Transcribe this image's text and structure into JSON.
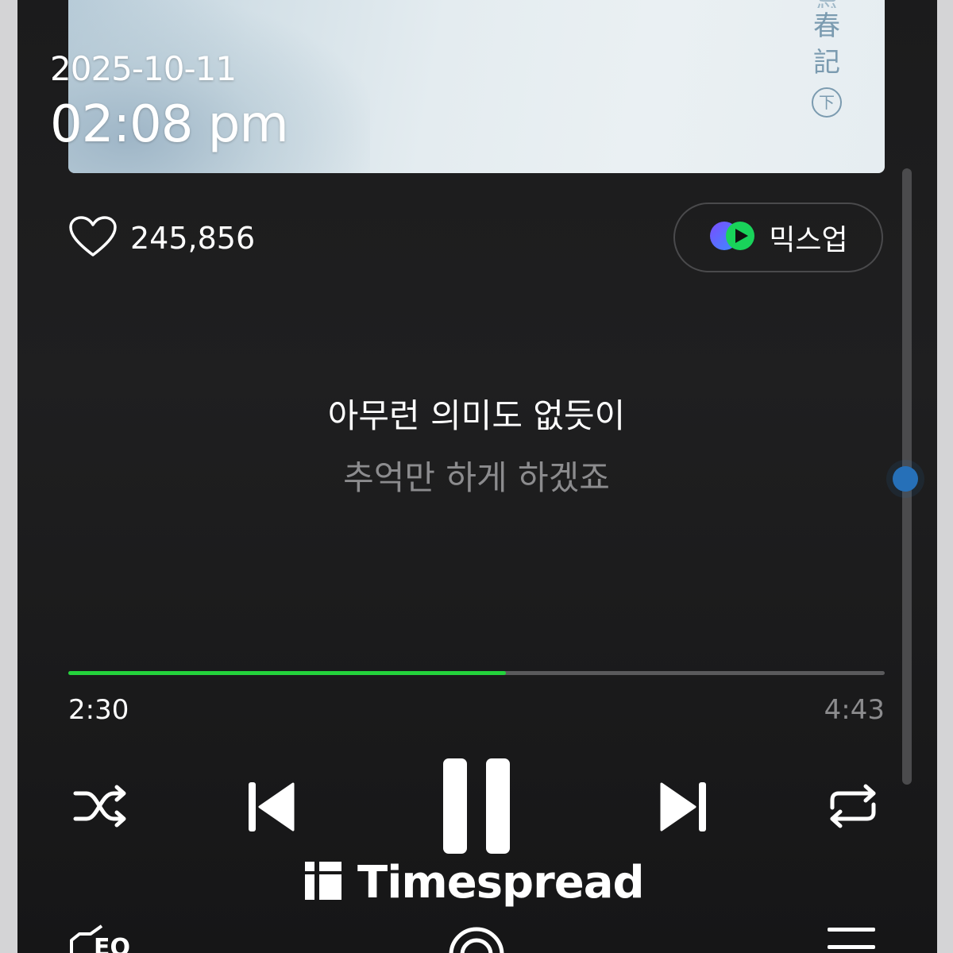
{
  "overlay": {
    "date": "2025-10-11",
    "time": "02:08 pm"
  },
  "album_art": {
    "title_glyphs": "春\n記",
    "badge": "下"
  },
  "likes": {
    "count": "245,856",
    "icon": "heart-icon"
  },
  "mixup": {
    "label": "믹스업",
    "icon": "mixup-icon"
  },
  "lyrics": {
    "current": "아무런 의미도 없듯이",
    "next": "추억만 하게 하겠죠"
  },
  "progress": {
    "elapsed": "2:30",
    "total": "4:43",
    "fraction": 0.5357,
    "color": "#24d33c"
  },
  "controls": {
    "shuffle": "shuffle-icon",
    "previous": "skip-previous-icon",
    "play_pause": "pause-icon",
    "next": "skip-next-icon",
    "repeat": "repeat-icon"
  },
  "watermark": {
    "text": "Timespread"
  },
  "bottom_bar": {
    "eq_label": "EQ",
    "center_icon": "circle-icon",
    "menu_icon": "menu-icon"
  },
  "colors": {
    "background": "#1b1b1c",
    "accent_green": "#24d33c",
    "scroll_thumb": "#2670b8"
  }
}
